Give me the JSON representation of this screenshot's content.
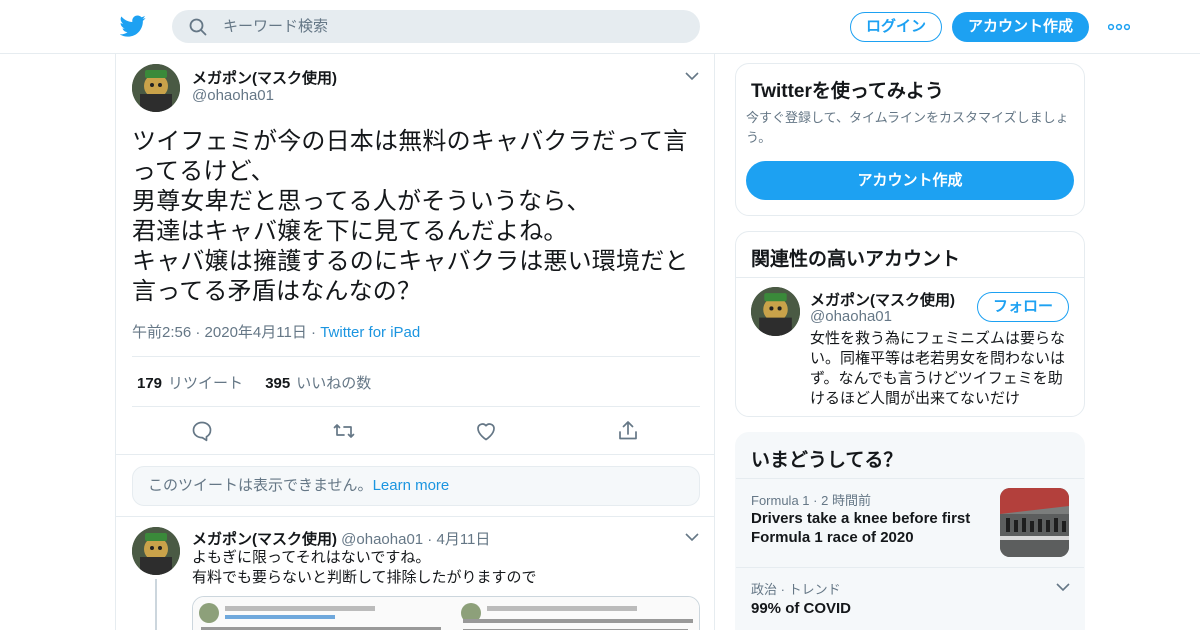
{
  "header": {
    "search_placeholder": "キーワード検索",
    "login_label": "ログイン",
    "signup_label": "アカウント作成"
  },
  "colors": {
    "accent": "#1da1f2",
    "link": "#1b95e0",
    "text": "#14171a",
    "muted": "#657786",
    "border": "#e6ecf0"
  },
  "tweet": {
    "author_name": "メガポン(マスク使用)",
    "author_handle": "@ohaoha01",
    "text": "ツイフェミが今の日本は無料のキャバクラだって言\nってるけど、\n男尊女卑だと思ってる人がそういうなら、\n君達はキャバ嬢を下に見てるんだよね。\nキャバ嬢は擁護するのにキャバクラは悪い環境だと\n言ってる矛盾はなんなの？",
    "time": "午前2:56",
    "date": "2020年4月11日",
    "source": "Twitter for iPad",
    "retweet_count": "179",
    "retweet_label": "リツイート",
    "like_count": "395",
    "like_label": "いいねの数"
  },
  "unavailable": {
    "text": "このツイートは表示できません。",
    "link": "Learn more"
  },
  "reply": {
    "author_name": "メガポン(マスク使用)",
    "author_handle": "@ohaoha01",
    "date": "4月11日",
    "text": "よもぎに限ってそれはないですね。\n有料でも要らないと判断して排除したがりますので"
  },
  "sidebar": {
    "signup_card": {
      "title": "Twitterを使ってみよう",
      "description": "今すぐ登録して、タイムラインをカスタマイズしましょう。",
      "button": "アカウント作成"
    },
    "related": {
      "title": "関連性の高いアカウント",
      "name": "メガポン(マスク使用)",
      "handle": "@ohaoha01",
      "follow_label": "フォロー",
      "bio": "女性を救う為にフェミニズムは要らない。同権平等は老若男女を問わないはず。なんでも言うけどツイフェミを助けるほど人間が出来てないだけ"
    },
    "trends": {
      "title": "いまどうしてる？",
      "items": [
        {
          "meta_source": "Formula 1",
          "meta_time": "2 時間前",
          "title": "Drivers take a knee before first Formula 1 race of 2020"
        },
        {
          "meta_source": "政治",
          "meta_time": "トレンド",
          "title": "99% of COVID"
        }
      ]
    }
  }
}
